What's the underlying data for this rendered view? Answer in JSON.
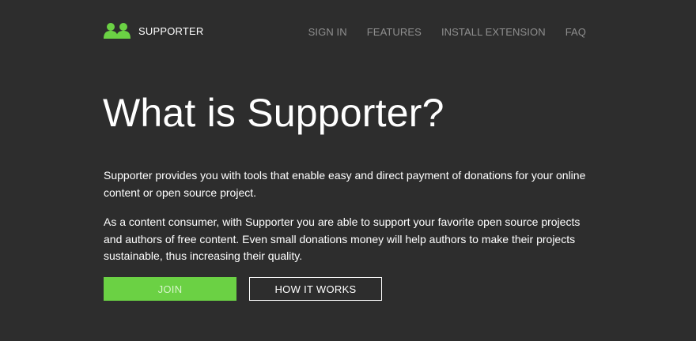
{
  "nav": {
    "brand_name": "SUPPORTER",
    "logo_icon": "people-icon",
    "links": [
      {
        "label": "SIGN IN"
      },
      {
        "label": "FEATURES"
      },
      {
        "label": "INSTALL EXTENSION"
      },
      {
        "label": "FAQ"
      }
    ]
  },
  "hero": {
    "title": "What is Supporter?",
    "paragraphs": [
      "Supporter provides you with tools that enable easy and direct payment of donations for your online content or open source project.",
      "As a content consumer, with Supporter you are able to support your favorite open source projects and authors of free content. Even small donations money will help authors to make their projects sustainable, thus increasing their quality."
    ],
    "join_label": "JOIN",
    "how_label": "HOW IT WORKS"
  },
  "colors": {
    "background": "#2d2d2d",
    "accent": "#6bd144",
    "nav_link": "#8f8f8f",
    "text": "#ffffff"
  }
}
